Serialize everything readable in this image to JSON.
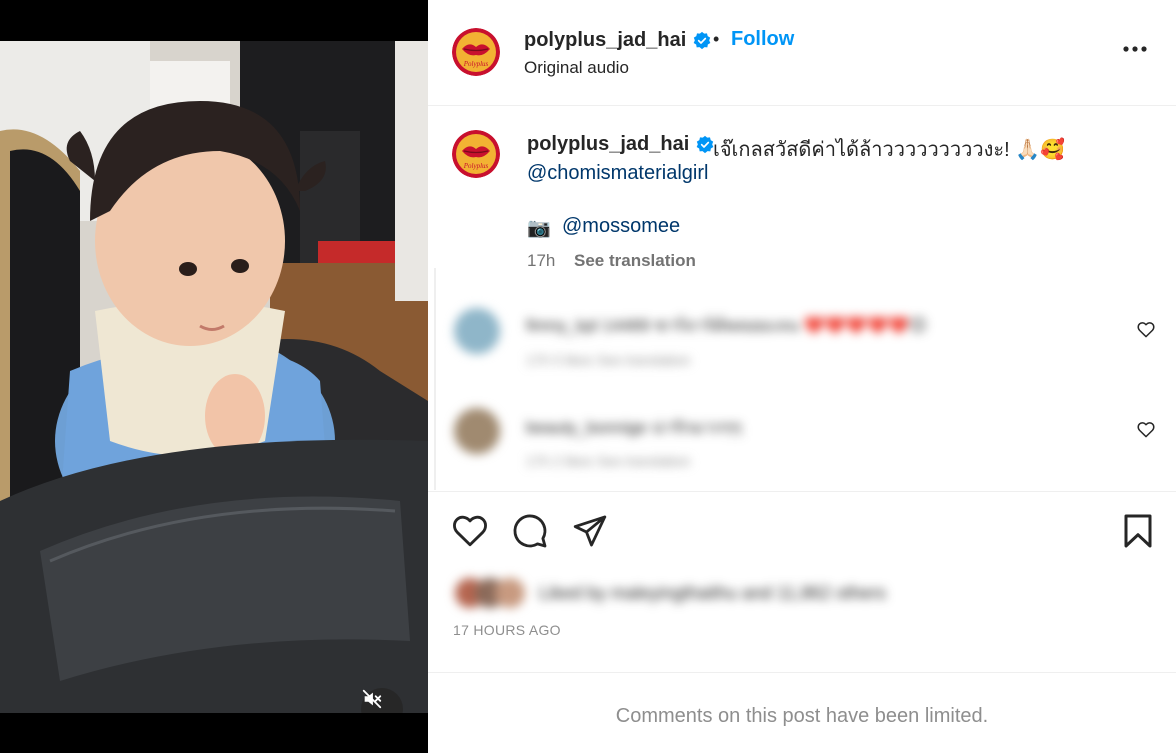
{
  "post": {
    "username": "polyplus_jad_hai",
    "follow_label": "Follow",
    "separator": "•",
    "audio_label": "Original audio"
  },
  "caption": {
    "username": "polyplus_jad_hai",
    "text": "เจ๊เกลสวัสดีค่าได้ล้าวววววววววงะ! 🙏🏻🥰",
    "mention": "@chomismaterialgirl",
    "camera_icon": "📷",
    "photo_credit": "@mossomee",
    "time": "17h",
    "see_translation": "See translation"
  },
  "comments": [
    {
      "text": "fimny_kpl 14489 ชาร์จาร์ต์พลอยแจน ❤️❤️❤️❤️❤️😊",
      "meta": "17h   5 likes   See translation",
      "avatar_color": "#8fb6c9"
    },
    {
      "text": "beauty_bonnige น่ารักมากๆๆ",
      "meta": "17h   2 likes   See translation",
      "avatar_color": "#a08a70"
    }
  ],
  "footer": {
    "liked_by": "Liked by maleyingthaithu and 11,862 others",
    "hours_ago": "17 HOURS AGO",
    "comments_limited": "Comments on this post have been limited."
  },
  "icons": {
    "verified": "verified-badge-icon",
    "more": "more-options-icon",
    "like": "heart-icon",
    "comment": "comment-icon",
    "share": "share-icon",
    "save": "bookmark-icon",
    "mute": "speaker-muted-icon"
  },
  "colors": {
    "follow_blue": "#0095f6",
    "mention_blue": "#00376b",
    "verified_blue": "#0095f6",
    "brand_red": "#c8102e",
    "brand_gold": "#f2b233"
  }
}
